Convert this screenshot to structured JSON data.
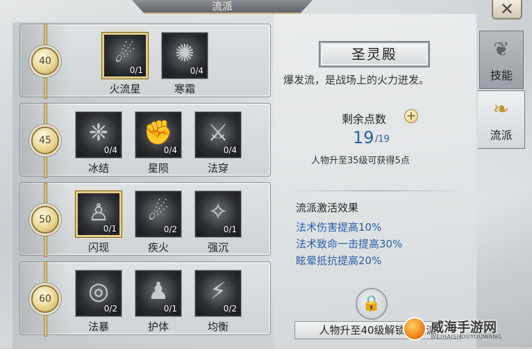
{
  "header": {
    "title": "流派",
    "close_label": "✕"
  },
  "tree": {
    "rows": [
      {
        "level": "40",
        "skills": [
          {
            "name": "火流星",
            "count": "0/1",
            "learned": true,
            "icon": "meteor-icon",
            "glyph": "☄"
          },
          {
            "name": "寒霜",
            "count": "0/4",
            "learned": false,
            "icon": "frost-icon",
            "glyph": "✺"
          }
        ]
      },
      {
        "level": "45",
        "skills": [
          {
            "name": "冰结",
            "count": "0/4",
            "learned": false,
            "icon": "ice-bird-icon",
            "glyph": "❈"
          },
          {
            "name": "星陨",
            "count": "0/4",
            "learned": false,
            "icon": "star-fall-icon",
            "glyph": "✊"
          },
          {
            "name": "法穿",
            "count": "0/4",
            "learned": false,
            "icon": "spell-pierce-icon",
            "glyph": "⚔"
          }
        ]
      },
      {
        "level": "50",
        "skills": [
          {
            "name": "闪现",
            "count": "0/1",
            "learned": true,
            "icon": "blink-icon",
            "glyph": "♙"
          },
          {
            "name": "疾火",
            "count": "0/2",
            "learned": false,
            "icon": "swift-fire-icon",
            "glyph": "☄"
          },
          {
            "name": "强沉",
            "count": "0/1",
            "learned": false,
            "icon": "sink-icon",
            "glyph": "✧"
          }
        ]
      },
      {
        "level": "60",
        "skills": [
          {
            "name": "法暴",
            "count": "0/2",
            "learned": false,
            "icon": "vortex-icon",
            "glyph": "◎"
          },
          {
            "name": "护体",
            "count": "0/1",
            "learned": false,
            "icon": "body-guard-icon",
            "glyph": "♟"
          },
          {
            "name": "均衡",
            "count": "0/2",
            "learned": false,
            "icon": "balance-icon",
            "glyph": "⚡"
          }
        ]
      }
    ]
  },
  "info": {
    "school_name": "圣灵殿",
    "description": "爆发流，是战场上的火力迸发。",
    "points_label": "剩余点数",
    "points_plus": "+",
    "points_value": "19",
    "points_max": "/19",
    "points_hint": "人物升至35级可获得5点",
    "effects_title": "流派激活效果",
    "effects": [
      "法术伤害提高10%",
      "法术致命一击提高30%",
      "眩晕抵抗提高20%"
    ],
    "unlock_text": "人物升至40级解锁该流派"
  },
  "tabs": [
    {
      "label": "技能",
      "icon": "skill-book-icon",
      "glyph": "❦",
      "active": false
    },
    {
      "label": "流派",
      "icon": "school-scroll-icon",
      "glyph": "❧",
      "active": true
    }
  ],
  "watermark": {
    "name": "威海手游网",
    "sub": "WEIHAISHOUYOUWANG"
  },
  "colors": {
    "accent_blue": "#2a5fa8",
    "gold": "#e4cf84"
  }
}
